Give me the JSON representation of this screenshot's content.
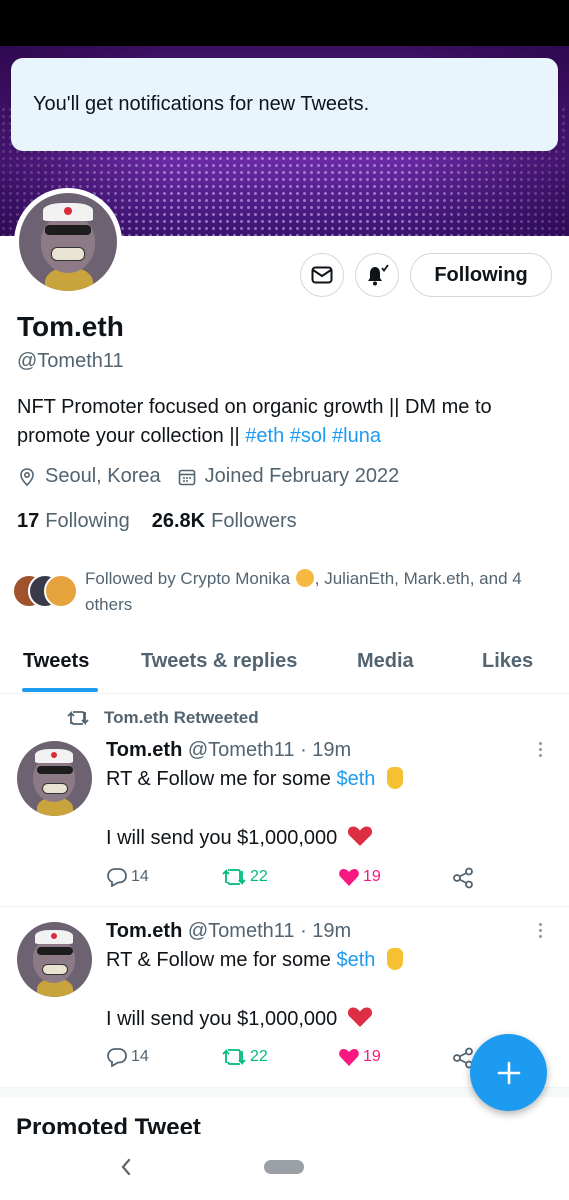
{
  "toast": {
    "text": "You'll get notifications for new Tweets."
  },
  "profile": {
    "name": "Tom.eth",
    "handle": "@Tometh11",
    "bio_plain": "NFT Promoter focused on organic growth || DM me to promote your collection ||",
    "bio_tags": [
      "#eth",
      "#sol",
      "#luna"
    ],
    "location": "Seoul, Korea",
    "joined": "Joined February 2022",
    "following_count": "17",
    "following_label": "Following",
    "followers_count": "26.8K",
    "followers_label": "Followers",
    "follow_button": "Following",
    "followed_by_prefix": "Followed by Crypto Monika",
    "followed_by_suffix": ", JulianEth, Mark.eth, and 4 others"
  },
  "tabs": [
    {
      "label": "Tweets",
      "active": true
    },
    {
      "label": "Tweets & replies",
      "active": false
    },
    {
      "label": "Media",
      "active": false
    },
    {
      "label": "Likes",
      "active": false
    }
  ],
  "retweet_label": "Tom.eth Retweeted",
  "tweets": [
    {
      "name": "Tom.eth",
      "handle": "@Tometh11",
      "time": "· 19m",
      "line1_text": "RT & Follow me for some",
      "line1_cashtag": "$eth",
      "line2_text": "I will send you $1,000,000",
      "replies": "14",
      "retweets": "22",
      "likes": "19"
    },
    {
      "name": "Tom.eth",
      "handle": "@Tometh11",
      "time": "· 19m",
      "line1_text": "RT & Follow me for some",
      "line1_cashtag": "$eth",
      "line2_text": "I will send you $1,000,000",
      "replies": "14",
      "retweets": "22",
      "likes": "19"
    }
  ],
  "promoted_label": "Promoted Tweet",
  "colors": {
    "accent": "#1d9bf0",
    "retweet": "#00ba7c",
    "like": "#f91880",
    "secondary_text": "#536471"
  },
  "icons": [
    "mail-icon",
    "bell-check-icon",
    "location-pin-icon",
    "calendar-icon",
    "retweet-icon",
    "reply-icon",
    "heart-icon",
    "share-icon",
    "more-icon",
    "compose-plus-icon",
    "nav-back-icon"
  ]
}
